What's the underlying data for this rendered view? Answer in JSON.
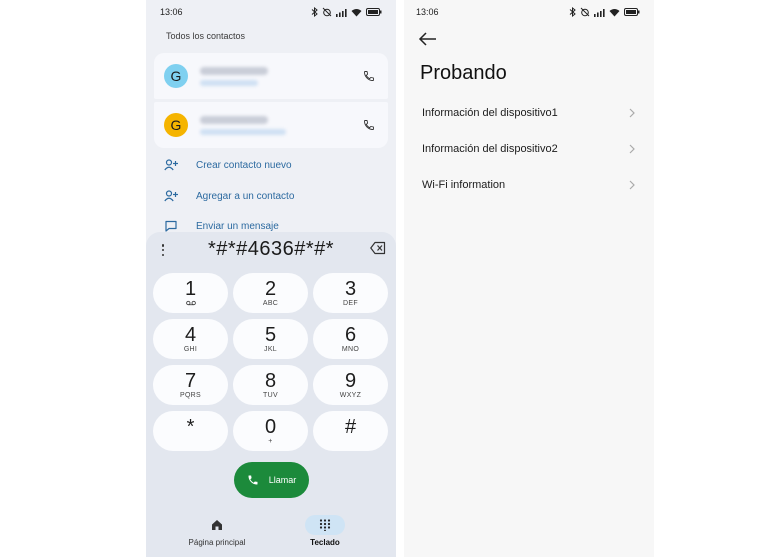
{
  "left_phone": {
    "status_time": "13:06",
    "section_title": "Todos los contactos",
    "contacts": [
      {
        "avatar_letter": "G",
        "avatar_color": "#7fd0f0"
      },
      {
        "avatar_letter": "G",
        "avatar_color": "#f5b400"
      }
    ],
    "actions": [
      {
        "label": "Crear contacto nuevo",
        "icon": "add-person-icon"
      },
      {
        "label": "Agregar a un contacto",
        "icon": "add-person-icon"
      },
      {
        "label": "Enviar un mensaje",
        "icon": "message-icon"
      }
    ],
    "dial_input": "*#*#4636#*#*",
    "keys": [
      {
        "digit": "1",
        "letters": ""
      },
      {
        "digit": "2",
        "letters": "ABC"
      },
      {
        "digit": "3",
        "letters": "DEF"
      },
      {
        "digit": "4",
        "letters": "GHI"
      },
      {
        "digit": "5",
        "letters": "JKL"
      },
      {
        "digit": "6",
        "letters": "MNO"
      },
      {
        "digit": "7",
        "letters": "PQRS"
      },
      {
        "digit": "8",
        "letters": "TUV"
      },
      {
        "digit": "9",
        "letters": "WXYZ"
      },
      {
        "digit": "*",
        "letters": ""
      },
      {
        "digit": "0",
        "letters": "+"
      },
      {
        "digit": "#",
        "letters": ""
      }
    ],
    "call_label": "Llamar",
    "call_color": "#1c8a3b",
    "nav": {
      "home_label": "Página principal",
      "keypad_label": "Teclado"
    }
  },
  "right_phone": {
    "status_time": "13:06",
    "title": "Probando",
    "menu_items": [
      "Información del dispositivo1",
      "Información del dispositivo2",
      "Wi-Fi information"
    ]
  }
}
